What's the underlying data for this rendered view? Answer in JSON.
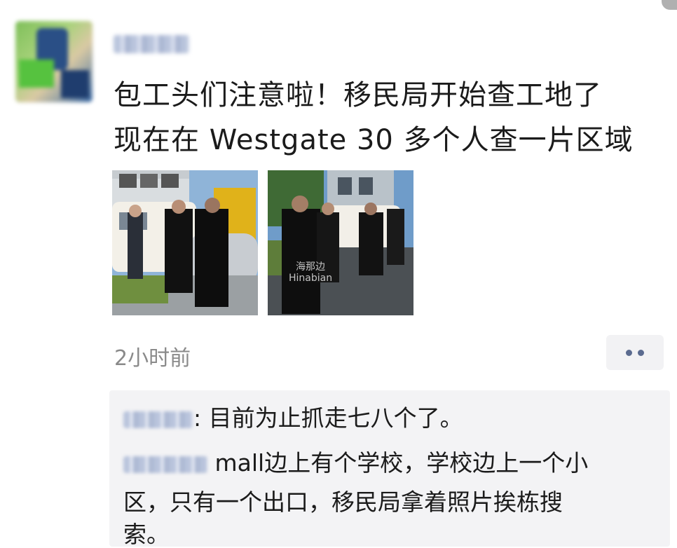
{
  "post": {
    "text_line1": "包工头们注意啦！移民局开始查工地了",
    "text_line2": "现在在 Westgate 30 多个人查一片区域",
    "time": "2小时前",
    "photo2_watermark_cn": "海那边",
    "photo2_watermark_en": "Hinabian"
  },
  "comments": [
    {
      "text": "目前为止抓走七八个了。"
    },
    {
      "text_line1": "mall边上有个学校，学校边上一个小",
      "text_line2": "区，只有一个出口，移民局拿着照片挨栋搜",
      "text_line3": "索。"
    }
  ],
  "icons": [
    "more-options-icon"
  ]
}
